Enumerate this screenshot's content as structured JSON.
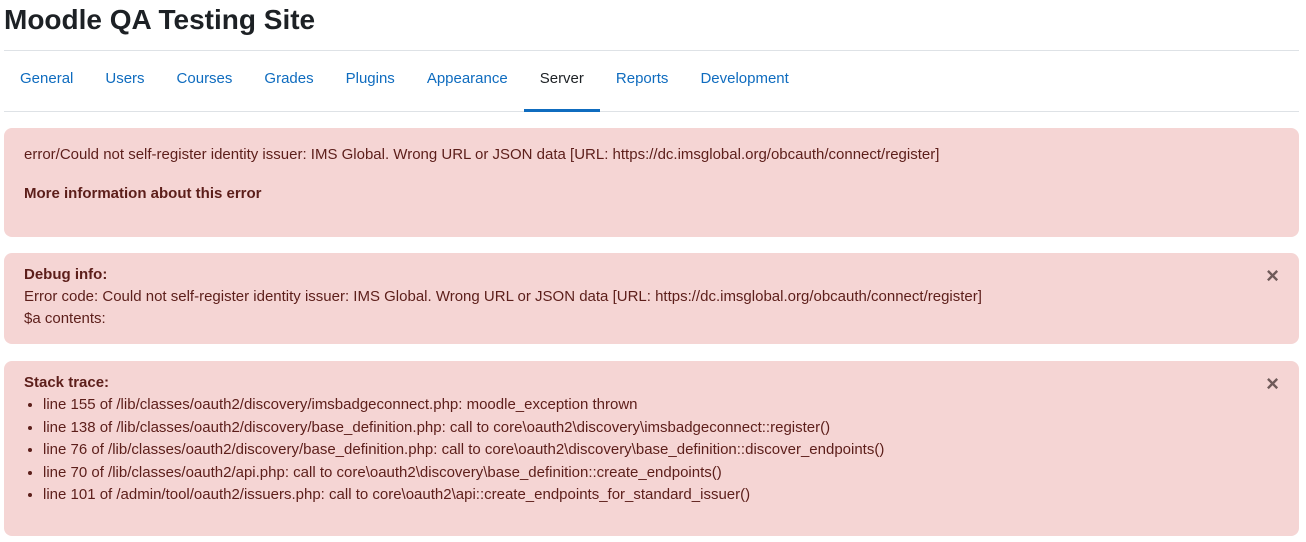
{
  "site": {
    "title": "Moodle QA Testing Site"
  },
  "nav": {
    "tabs": [
      {
        "label": "General"
      },
      {
        "label": "Users"
      },
      {
        "label": "Courses"
      },
      {
        "label": "Grades"
      },
      {
        "label": "Plugins"
      },
      {
        "label": "Appearance"
      },
      {
        "label": "Server",
        "active": true
      },
      {
        "label": "Reports"
      },
      {
        "label": "Development"
      }
    ]
  },
  "error_alert": {
    "message": "error/Could not self-register identity issuer: IMS Global. Wrong URL or JSON data [URL: https://dc.imsglobal.org/obcauth/connect/register]",
    "more_info": "More information about this error"
  },
  "debug_alert": {
    "heading": "Debug info:",
    "error_code": "Error code: Could not self-register identity issuer: IMS Global. Wrong URL or JSON data [URL: https://dc.imsglobal.org/obcauth/connect/register]",
    "a_contents": "$a contents:",
    "close": "×"
  },
  "trace_alert": {
    "heading": "Stack trace:",
    "close": "×",
    "lines": [
      "line 155 of /lib/classes/oauth2/discovery/imsbadgeconnect.php: moodle_exception thrown",
      "line 138 of /lib/classes/oauth2/discovery/base_definition.php: call to core\\oauth2\\discovery\\imsbadgeconnect::register()",
      "line 76 of /lib/classes/oauth2/discovery/base_definition.php: call to core\\oauth2\\discovery\\base_definition::discover_endpoints()",
      "line 70 of /lib/classes/oauth2/api.php: call to core\\oauth2\\discovery\\base_definition::create_endpoints()",
      "line 101 of /admin/tool/oauth2/issuers.php: call to core\\oauth2\\api::create_endpoints_for_standard_issuer()"
    ]
  }
}
